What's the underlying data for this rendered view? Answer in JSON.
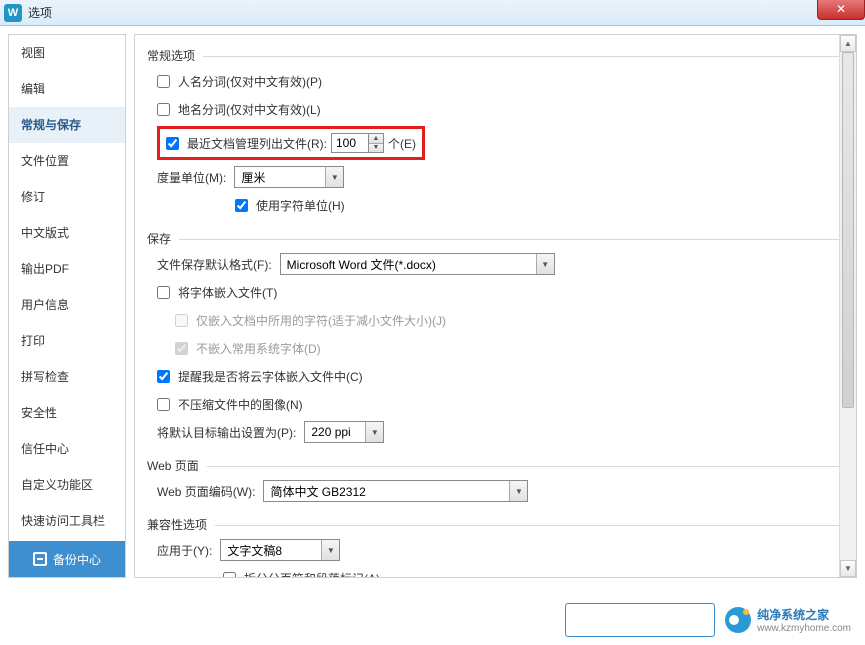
{
  "window": {
    "title": "选项"
  },
  "sidebar": {
    "items": [
      {
        "label": "视图"
      },
      {
        "label": "编辑"
      },
      {
        "label": "常规与保存"
      },
      {
        "label": "文件位置"
      },
      {
        "label": "修订"
      },
      {
        "label": "中文版式"
      },
      {
        "label": "输出PDF"
      },
      {
        "label": "用户信息"
      },
      {
        "label": "打印"
      },
      {
        "label": "拼写检查"
      },
      {
        "label": "安全性"
      },
      {
        "label": "信任中心"
      },
      {
        "label": "自定义功能区"
      },
      {
        "label": "快速访问工具栏"
      }
    ],
    "backup_label": "备份中心"
  },
  "sections": {
    "general": {
      "title": "常规选项",
      "name_seg": "人名分词(仅对中文有效)(P)",
      "place_seg": "地名分词(仅对中文有效)(L)",
      "recent_docs_label": "最近文档管理列出文件(R):",
      "recent_docs_value": "100",
      "recent_docs_unit": "个(E)",
      "unit_label": "度量单位(M):",
      "unit_value": "厘米",
      "char_unit": "使用字符单位(H)"
    },
    "save": {
      "title": "保存",
      "default_format_label": "文件保存默认格式(F):",
      "default_format_value": "Microsoft Word 文件(*.docx)",
      "embed_fonts": "将字体嵌入文件(T)",
      "embed_only_used": "仅嵌入文档中所用的字符(适于减小文件大小)(J)",
      "no_embed_sys": "不嵌入常用系统字体(D)",
      "remind_cloud": "提醒我是否将云字体嵌入文件中(C)",
      "no_compress_img": "不压缩文件中的图像(N)",
      "target_output_label": "将默认目标输出设置为(P):",
      "target_output_value": "220 ppi"
    },
    "web": {
      "title": "Web 页面",
      "encoding_label": "Web 页面编码(W):",
      "encoding_value": "简体中文 GB2312"
    },
    "compat": {
      "title": "兼容性选项",
      "apply_label": "应用于(Y):",
      "apply_value": "文字文稿8",
      "split_marks": "拆分分页符和段落标记(A)"
    }
  },
  "watermark": {
    "brand": "纯净系统之家",
    "url": "www.kzmyhome.com"
  }
}
